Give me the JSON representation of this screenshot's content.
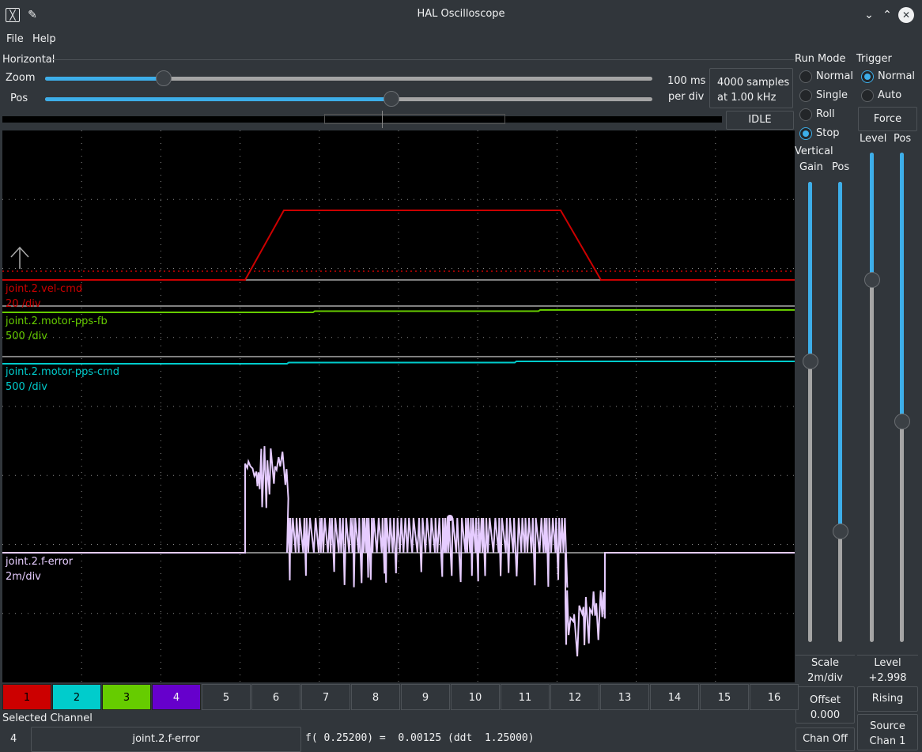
{
  "window": {
    "title": "HAL Oscilloscope"
  },
  "menu": [
    {
      "label": "File"
    },
    {
      "label": "Help"
    }
  ],
  "horizontal": {
    "group_label": "Horizontal",
    "zoom_label": "Zoom",
    "zoom_value": 0.195,
    "pos_label": "Pos",
    "pos_value": 0.57,
    "rate_line1": "100 ms",
    "rate_line2": "per div",
    "samples_line1": "4000 samples",
    "samples_line2": "at 1.00 kHz",
    "status": "IDLE"
  },
  "run_mode": {
    "group_label": "Run Mode",
    "options": [
      {
        "label": "Normal",
        "selected": false
      },
      {
        "label": "Single",
        "selected": false
      },
      {
        "label": "Roll",
        "selected": false
      },
      {
        "label": "Stop",
        "selected": true
      }
    ]
  },
  "trigger": {
    "group_label": "Trigger",
    "options": [
      {
        "label": "Normal",
        "selected": true
      },
      {
        "label": "Auto",
        "selected": false
      }
    ],
    "force_label": "Force",
    "level_label": "Level",
    "pos_label": "Pos",
    "level_value": 0.26,
    "pos_value": 0.55,
    "level_title": "Level",
    "level_readout": "+2.998",
    "edge_label": "Rising",
    "source_label": "Source",
    "source_value": "Chan  1"
  },
  "vertical": {
    "group_label": "Vertical",
    "gain_label": "Gain",
    "pos_label": "Pos",
    "gain_value": 0.39,
    "pos_value": 0.76,
    "scale_label": "Scale",
    "scale_value": "2m/div",
    "offset_label": "Offset",
    "offset_value": "0.000",
    "chan_off_label": "Chan Off"
  },
  "traces": [
    {
      "name": "joint.2.vel-cmd",
      "scale": "20 /div",
      "color": "#cc0000"
    },
    {
      "name": "joint.2.motor-pps-fb",
      "scale": "500 /div",
      "color": "#66cc00"
    },
    {
      "name": "joint.2.motor-pps-cmd",
      "scale": "500 /div",
      "color": "#00cccc"
    },
    {
      "name": "joint.2.f-error",
      "scale": "2m/div",
      "color": "#e6ccff"
    }
  ],
  "channels": [
    {
      "label": "1",
      "color": "#cc0000"
    },
    {
      "label": "2",
      "color": "#00cccc"
    },
    {
      "label": "3",
      "color": "#66cc00"
    },
    {
      "label": "4",
      "color": "#6600cc"
    },
    {
      "label": "5",
      "color": ""
    },
    {
      "label": "6",
      "color": ""
    },
    {
      "label": "7",
      "color": ""
    },
    {
      "label": "8",
      "color": ""
    },
    {
      "label": "9",
      "color": ""
    },
    {
      "label": "10",
      "color": ""
    },
    {
      "label": "11",
      "color": ""
    },
    {
      "label": "12",
      "color": ""
    },
    {
      "label": "13",
      "color": ""
    },
    {
      "label": "14",
      "color": ""
    },
    {
      "label": "15",
      "color": ""
    },
    {
      "label": "16",
      "color": ""
    }
  ],
  "selected": {
    "group_label": "Selected Channel",
    "number": "4",
    "name": "joint.2.f-error",
    "readout": "f( 0.25200) =  0.00125 (ddt  1.25000)"
  }
}
